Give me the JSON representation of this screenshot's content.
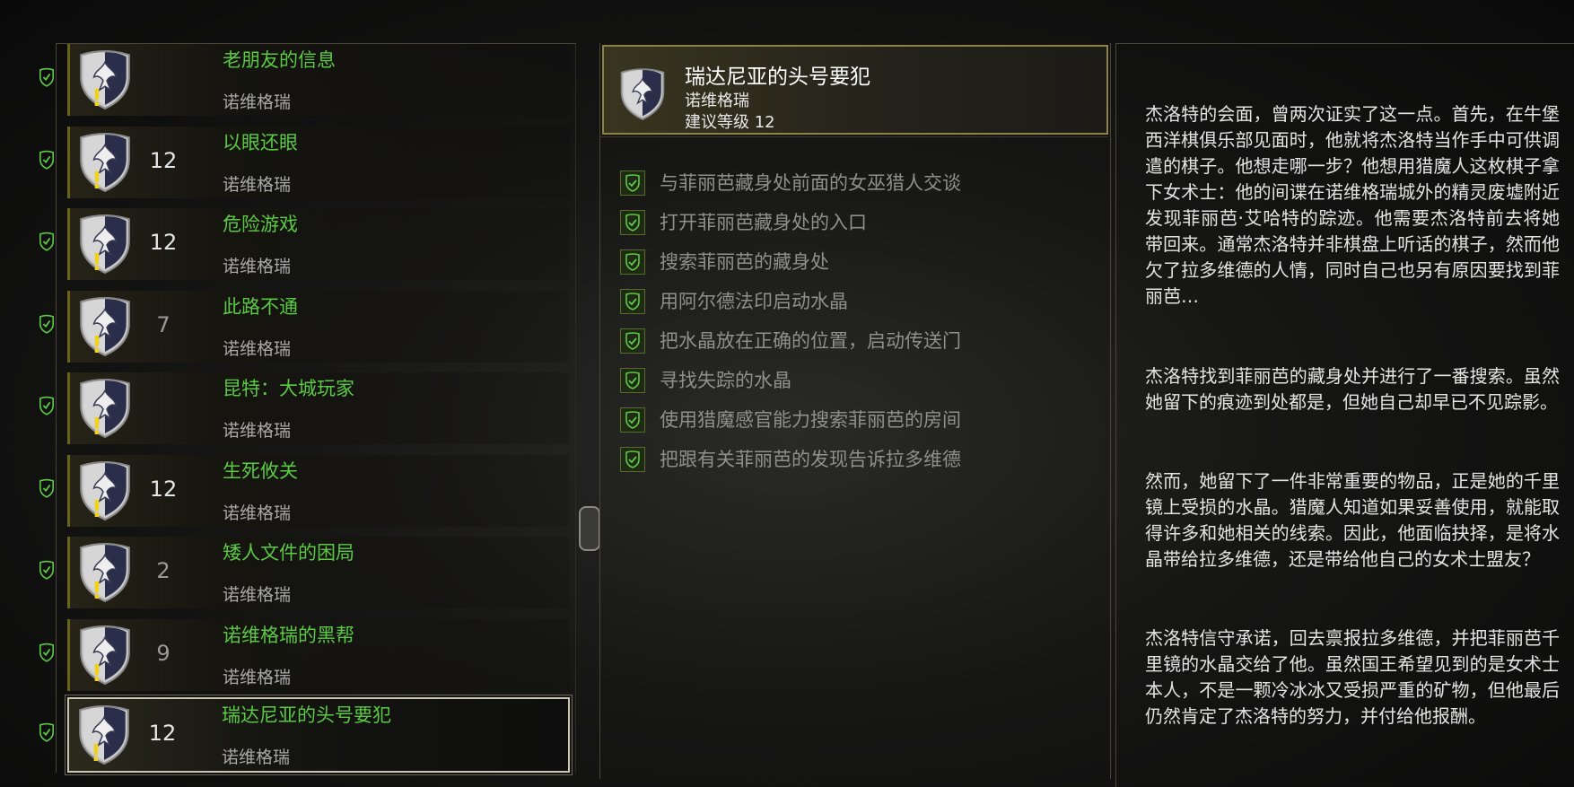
{
  "quests": [
    {
      "title": "老朋友的信息",
      "region": "诺维格瑞",
      "level": ""
    },
    {
      "title": "以眼还眼",
      "region": "诺维格瑞",
      "level": "12"
    },
    {
      "title": "危险游戏",
      "region": "诺维格瑞",
      "level": "12"
    },
    {
      "title": "此路不通",
      "region": "诺维格瑞",
      "level": "7"
    },
    {
      "title": "昆特：大城玩家",
      "region": "诺维格瑞",
      "level": ""
    },
    {
      "title": "生死攸关",
      "region": "诺维格瑞",
      "level": "12"
    },
    {
      "title": "矮人文件的困局",
      "region": "诺维格瑞",
      "level": "2"
    },
    {
      "title": "诺维格瑞的黑帮",
      "region": "诺维格瑞",
      "level": "9"
    },
    {
      "title": "瑞达尼亚的头号要犯",
      "region": "诺维格瑞",
      "level": "12"
    }
  ],
  "selected_quest": {
    "title": "瑞达尼亚的头号要犯",
    "region": "诺维格瑞",
    "recommended_level": "建议等级 12"
  },
  "objectives": [
    "与菲丽芭藏身处前面的女巫猎人交谈",
    "打开菲丽芭藏身处的入口",
    "搜索菲丽芭的藏身处",
    "用阿尔德法印启动水晶",
    "把水晶放在正确的位置，启动传送门",
    "寻找失踪的水晶",
    "使用猎魔感官能力搜索菲丽芭的房间",
    "把跟有关菲丽芭的发现告诉拉多维德"
  ],
  "description": [
    "杰洛特的会面，曾两次证实了这一点。首先，在牛堡西洋棋俱乐部见面时，他就将杰洛特当作手中可供调遣的棋子。他想走哪一步？他想用猎魔人这枚棋子拿下女术士：他的间谍在诺维格瑞城外的精灵废墟附近发现菲丽芭·艾哈特的踪迹。他需要杰洛特前去将她带回来。通常杰洛特并非棋盘上听话的棋子，然而他欠了拉多维德的人情，同时自己也另有原因要找到菲丽芭…",
    "杰洛特找到菲丽芭的藏身处并进行了一番搜索。虽然她留下的痕迹到处都是，但她自己却早已不见踪影。",
    "然而，她留下了一件非常重要的物品，正是她的千里镜上受损的水晶。猎魔人知道如果妥善使用，就能取得许多和她相关的线索。因此，他面临抉择，是将水晶带给拉多维德，还是带给他自己的女术士盟友？",
    "杰洛特信守承诺，回去禀报拉多维德，并把菲丽芭千里镜的水晶交给了他。虽然国王希望见到的是女术士本人，不是一颗冷冰冰又受损严重的矿物，但他最后仍然肯定了杰洛特的努力，并付给他报酬。"
  ],
  "icons": {
    "quest_complete": "check-shield-icon",
    "quest_emblem": "redania-shield-icon",
    "alert": "exclamation-icon"
  },
  "colors": {
    "quest_title": "#5cc945",
    "alert": "#f0d21d",
    "header_border": "#8c8245"
  }
}
